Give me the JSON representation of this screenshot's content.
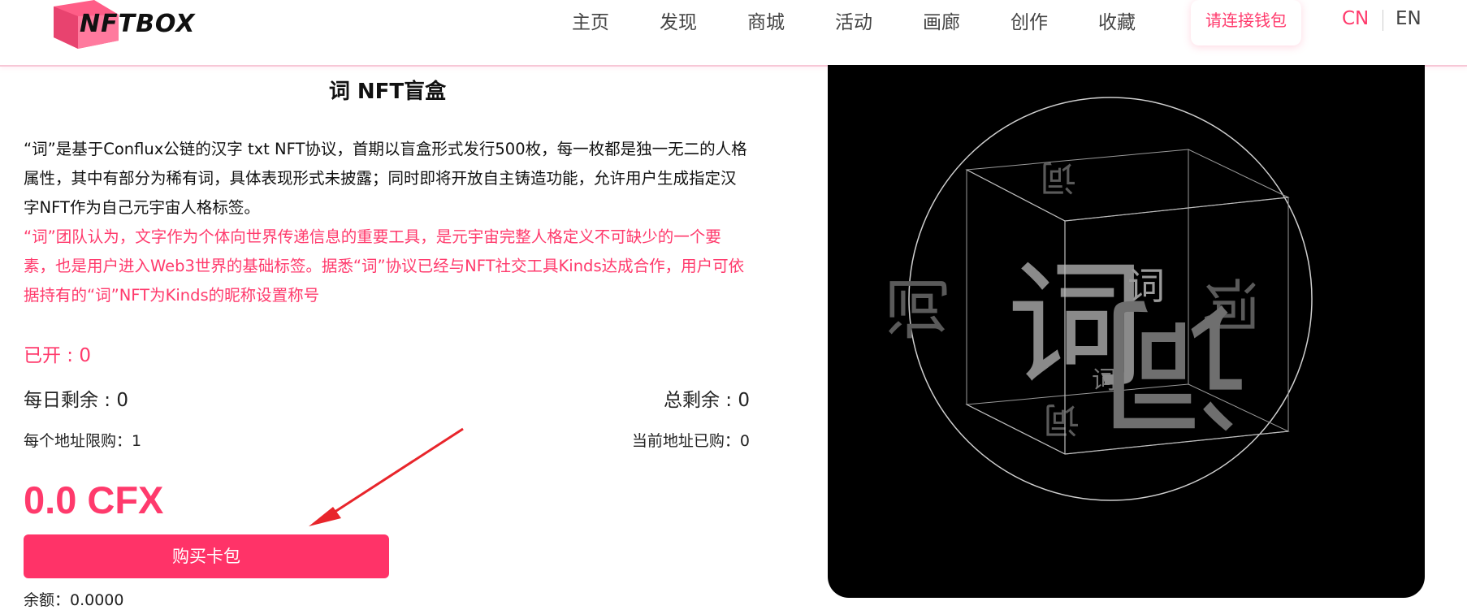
{
  "header": {
    "logo_text": "NFTBOX",
    "nav": [
      "主页",
      "发现",
      "商城",
      "活动",
      "画廊",
      "创作",
      "收藏"
    ],
    "wallet_button": "请连接钱包",
    "lang_cn": "CN",
    "lang_en": "EN"
  },
  "product": {
    "title": "词 NFT盲盒",
    "description": "“词”是基于Conflux公链的汉字 txt NFT协议，首期以盲盒形式发行500枚，每一枚都是独一无二的人格属性，其中有部分为稀有词，具体表现形式未披露；同时即将开放自主铸造功能，允许用户生成指定汉字NFT作为自己元宇宙人格标签。",
    "description_highlight": "“词”团队认为，文字作为个体向世界传递信息的重要工具，是元宇宙完整人格定义不可缺少的一个要素，也是用户进入Web3世界的基础标签。据悉“词”协议已经与NFT社交工具Kinds达成合作，用户可依据持有的“词”NFT为Kinds的昵称设置称号",
    "opened": "已开 : 0",
    "daily_remaining": "每日剩余 : 0",
    "total_remaining": "总剩余 : 0",
    "limit_per_address": "每个地址限购：1",
    "current_bought": "当前地址已购：0",
    "price": "0.0 CFX",
    "buy_button": "购买卡包",
    "balance": "余额：0.0000"
  },
  "preview": {
    "char": "词",
    "colors": {
      "background": "#000000",
      "line": "#cfcfcf",
      "glyph": "#8a8a8a"
    }
  },
  "colors": {
    "accent": "#ff3a6c",
    "button": "#ff3368"
  }
}
